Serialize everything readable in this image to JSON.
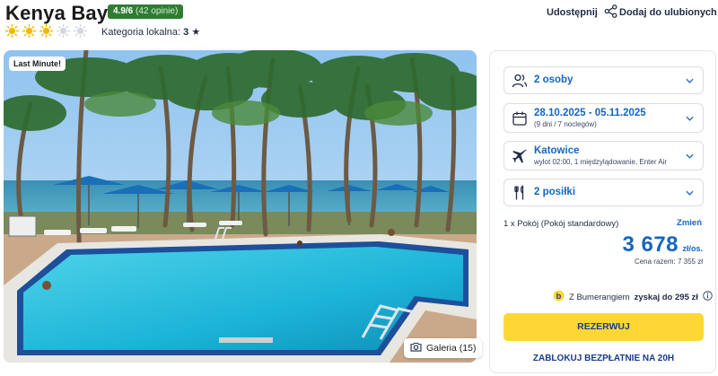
{
  "hotel": {
    "name": "Kenya Bay",
    "rating_score": "4.9/6",
    "rating_count": "(42 opinie)",
    "stars_filled": 3,
    "stars_total": 5,
    "category_label": "Kategoria lokalna:",
    "category_value": "3",
    "star_glyph": "★"
  },
  "actions": {
    "share_label": "Udostępnij",
    "favorite_label": "Dodaj do ulubionych"
  },
  "photo": {
    "badge": "Last Minute!",
    "gallery_label": "Galeria (15)"
  },
  "booking": {
    "persons": {
      "label": "2 osoby",
      "icon": "people-icon"
    },
    "dates": {
      "label": "28.10.2025 - 05.11.2025",
      "sub": "(9 dni / 7 noclegów)",
      "icon": "calendar-icon"
    },
    "flight": {
      "label": "Katowice",
      "sub": "wylot 02:00, 1 międzylądowanie, Enter Air",
      "icon": "plane-icon"
    },
    "meals": {
      "label": "2 posiłki",
      "icon": "fork-knife-icon"
    },
    "room_text": "1 x Pokój  (Pokój standardowy)",
    "change_label": "Zmień",
    "price": "3 678",
    "price_unit": "zł/os.",
    "total": "Cena razem: 7 355 zł",
    "boomerang_prefix": "Z Bumerangiem",
    "boomerang_highlight": "zyskaj do 295 zł",
    "reserve_label": "REZERWUJ",
    "block_label": "ZABLOKUJ BEZPŁATNIE NA 20H"
  },
  "colors": {
    "accent_blue": "#1565c0",
    "rating_green": "#2e7d32",
    "reserve_yellow": "#fdd835",
    "sun_yellow": "#f5b800"
  }
}
